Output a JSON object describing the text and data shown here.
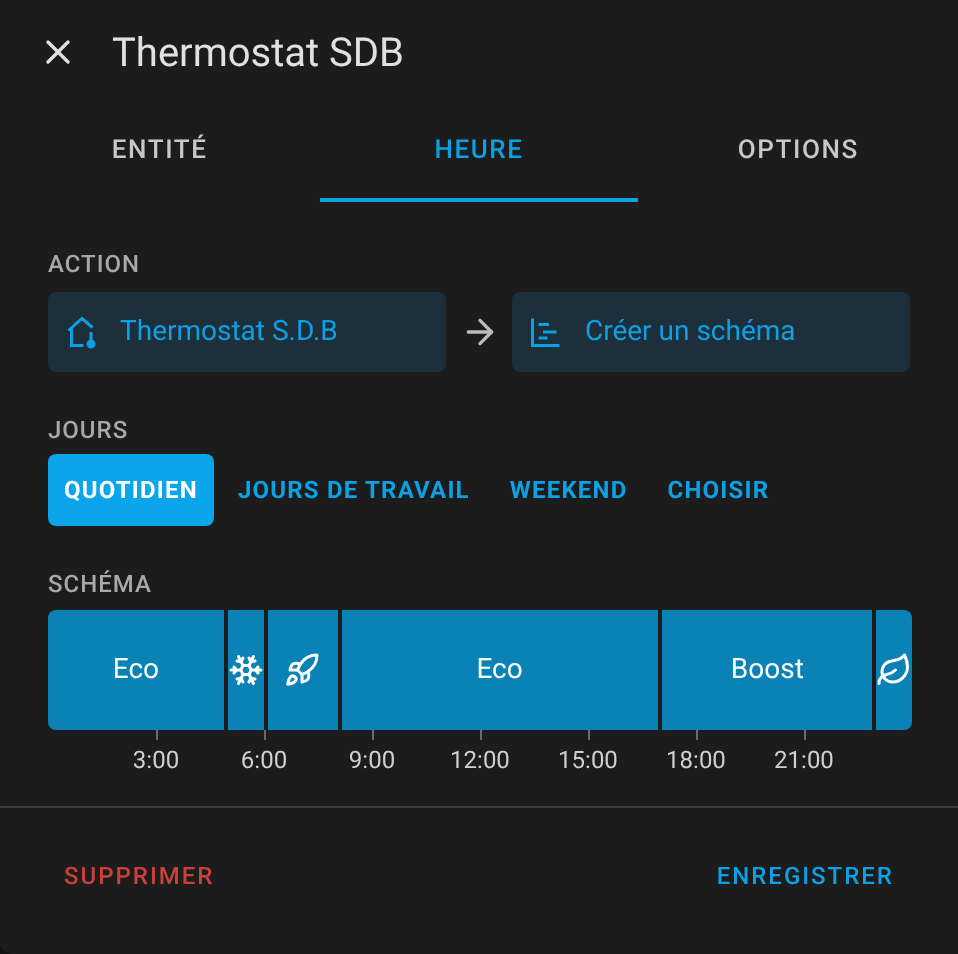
{
  "dialog": {
    "title": "Thermostat SDB"
  },
  "tabs": [
    {
      "label": "ENTITÉ",
      "selected": false
    },
    {
      "label": "HEURE",
      "selected": true
    },
    {
      "label": "OPTIONS",
      "selected": false
    }
  ],
  "action": {
    "label": "ACTION",
    "entity": "Thermostat S.D.B",
    "target": "Créer un schéma"
  },
  "days": {
    "label": "JOURS",
    "options": [
      {
        "label": "QUOTIDIEN",
        "selected": true
      },
      {
        "label": "JOURS DE TRAVAIL",
        "selected": false
      },
      {
        "label": "WEEKEND",
        "selected": false
      },
      {
        "label": "CHOISIR",
        "selected": false
      }
    ]
  },
  "schedule": {
    "label": "SCHÉMA",
    "segments": [
      {
        "kind": "text",
        "text": "Eco"
      },
      {
        "kind": "snowflake"
      },
      {
        "kind": "rocket"
      },
      {
        "kind": "text",
        "text": "Eco"
      },
      {
        "kind": "text",
        "text": "Boost"
      },
      {
        "kind": "leaf"
      }
    ],
    "axis": [
      "3:00",
      "6:00",
      "9:00",
      "12:00",
      "15:00",
      "18:00",
      "21:00"
    ]
  },
  "footer": {
    "delete": "SUPPRIMER",
    "save": "ENREGISTRER"
  }
}
